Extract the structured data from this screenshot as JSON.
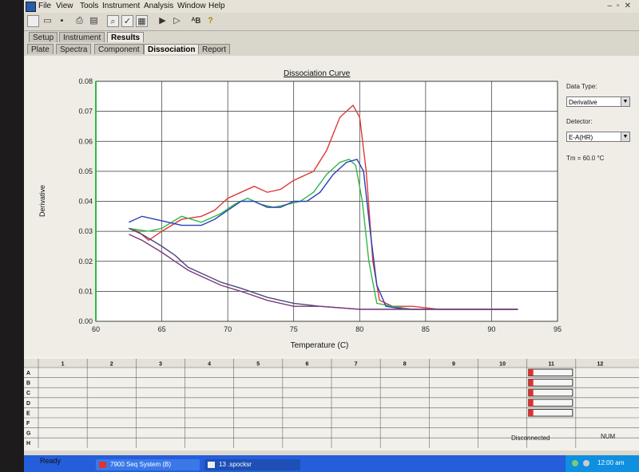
{
  "menu": [
    "File",
    "View",
    "Tools",
    "Instrument",
    "Analysis",
    "Window",
    "Help"
  ],
  "tabs_top": [
    "Setup",
    "Instrument",
    "Results"
  ],
  "tabs_sub": [
    "Plate",
    "Spectra",
    "Component",
    "Dissociation",
    "Report"
  ],
  "plot": {
    "title": "Dissociation Curve",
    "xlabel": "Temperature (C)",
    "ylabel": "Derivative"
  },
  "right_panel": {
    "data_type_label": "Data Type:",
    "data_type_value": "Derivative",
    "detector_label": "Detector:",
    "detector_value": "E-A(HR)",
    "tm_text": "Tm = 60.0 °C"
  },
  "grid": {
    "columns": [
      "1",
      "2",
      "3",
      "4",
      "5",
      "6",
      "7",
      "8",
      "9",
      "10",
      "11",
      "12"
    ],
    "rows": [
      "A",
      "B",
      "C",
      "D",
      "E",
      "F",
      "G",
      "H"
    ]
  },
  "status": {
    "left": "Ready",
    "middle": "Disconnected",
    "right": "NUM"
  },
  "taskbar": {
    "task1": "7900 Seq System (B)",
    "task2": "13 .spocksr",
    "clock": "12:00 am"
  },
  "chart_data": {
    "type": "line",
    "title": "Dissociation Curve",
    "xlabel": "Temperature (C)",
    "ylabel": "Derivative",
    "xlim": [
      60,
      95
    ],
    "ylim": [
      0,
      0.08
    ],
    "xticks": [
      60,
      65,
      70,
      75,
      80,
      85,
      90,
      95
    ],
    "yticks": [
      0.0,
      0.01,
      0.02,
      0.03,
      0.04,
      0.05,
      0.06,
      0.07,
      0.08
    ],
    "grid": true,
    "series": [
      {
        "color": "#e03838",
        "points": [
          [
            62.5,
            0.031
          ],
          [
            63.2,
            0.03
          ],
          [
            64.0,
            0.027
          ],
          [
            65.0,
            0.03
          ],
          [
            66.5,
            0.034
          ],
          [
            68.0,
            0.035
          ],
          [
            69.0,
            0.037
          ],
          [
            70.0,
            0.041
          ],
          [
            71.0,
            0.043
          ],
          [
            72.0,
            0.045
          ],
          [
            73.0,
            0.043
          ],
          [
            74.0,
            0.044
          ],
          [
            75.0,
            0.047
          ],
          [
            76.5,
            0.05
          ],
          [
            77.5,
            0.057
          ],
          [
            78.5,
            0.068
          ],
          [
            79.5,
            0.072
          ],
          [
            80.0,
            0.068
          ],
          [
            80.5,
            0.05
          ],
          [
            81.0,
            0.02
          ],
          [
            81.5,
            0.007
          ],
          [
            82.5,
            0.005
          ],
          [
            84.0,
            0.005
          ],
          [
            86.0,
            0.004
          ],
          [
            88.0,
            0.004
          ],
          [
            92.0,
            0.004
          ]
        ]
      },
      {
        "color": "#2fb84a",
        "points": [
          [
            62.5,
            0.031
          ],
          [
            64.0,
            0.03
          ],
          [
            65.0,
            0.031
          ],
          [
            66.5,
            0.035
          ],
          [
            68.0,
            0.033
          ],
          [
            69.5,
            0.036
          ],
          [
            70.5,
            0.039
          ],
          [
            71.5,
            0.041
          ],
          [
            72.5,
            0.039
          ],
          [
            73.5,
            0.038
          ],
          [
            74.5,
            0.039
          ],
          [
            75.5,
            0.04
          ],
          [
            76.5,
            0.043
          ],
          [
            77.5,
            0.049
          ],
          [
            78.5,
            0.053
          ],
          [
            79.2,
            0.054
          ],
          [
            79.7,
            0.052
          ],
          [
            80.2,
            0.04
          ],
          [
            80.7,
            0.02
          ],
          [
            81.3,
            0.006
          ],
          [
            82.5,
            0.005
          ],
          [
            84.0,
            0.004
          ],
          [
            88.0,
            0.004
          ],
          [
            92.0,
            0.004
          ]
        ]
      },
      {
        "color": "#2a3fb5",
        "points": [
          [
            62.5,
            0.033
          ],
          [
            63.5,
            0.035
          ],
          [
            64.5,
            0.034
          ],
          [
            65.5,
            0.033
          ],
          [
            66.5,
            0.032
          ],
          [
            68.0,
            0.032
          ],
          [
            69.0,
            0.034
          ],
          [
            70.0,
            0.037
          ],
          [
            71.0,
            0.04
          ],
          [
            72.0,
            0.04
          ],
          [
            73.0,
            0.038
          ],
          [
            74.0,
            0.038
          ],
          [
            75.0,
            0.04
          ],
          [
            76.0,
            0.04
          ],
          [
            77.0,
            0.043
          ],
          [
            78.0,
            0.049
          ],
          [
            79.0,
            0.053
          ],
          [
            79.8,
            0.054
          ],
          [
            80.3,
            0.05
          ],
          [
            80.8,
            0.03
          ],
          [
            81.3,
            0.012
          ],
          [
            82.0,
            0.005
          ],
          [
            83.5,
            0.004
          ],
          [
            86.0,
            0.004
          ],
          [
            89.0,
            0.004
          ],
          [
            92.0,
            0.004
          ]
        ]
      },
      {
        "color": "#4a4a7a",
        "points": [
          [
            62.5,
            0.031
          ],
          [
            63.5,
            0.029
          ],
          [
            65.0,
            0.025
          ],
          [
            66.0,
            0.022
          ],
          [
            67.0,
            0.018
          ],
          [
            68.0,
            0.016
          ],
          [
            69.5,
            0.013
          ],
          [
            71.0,
            0.011
          ],
          [
            73.0,
            0.008
          ],
          [
            75.0,
            0.006
          ],
          [
            77.0,
            0.005
          ],
          [
            80.0,
            0.004
          ],
          [
            85.0,
            0.004
          ],
          [
            92.0,
            0.004
          ]
        ]
      },
      {
        "color": "#7a3a7a",
        "points": [
          [
            62.5,
            0.029
          ],
          [
            63.5,
            0.027
          ],
          [
            65.0,
            0.023
          ],
          [
            66.0,
            0.02
          ],
          [
            67.0,
            0.017
          ],
          [
            68.0,
            0.015
          ],
          [
            69.5,
            0.012
          ],
          [
            71.0,
            0.01
          ],
          [
            73.0,
            0.007
          ],
          [
            75.0,
            0.005
          ],
          [
            77.0,
            0.005
          ],
          [
            80.0,
            0.004
          ],
          [
            85.0,
            0.004
          ],
          [
            92.0,
            0.004
          ]
        ]
      }
    ]
  }
}
